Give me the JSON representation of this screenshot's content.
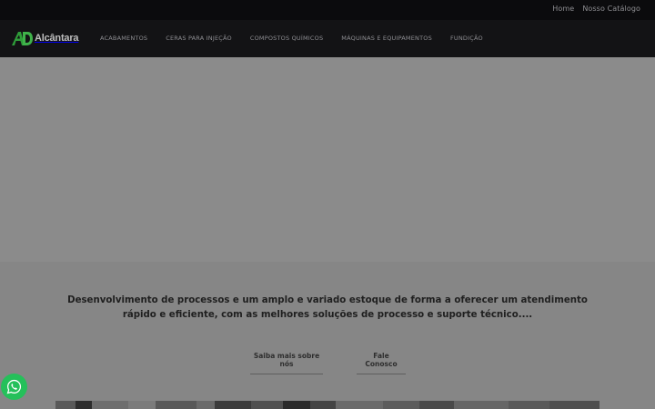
{
  "top_links": [
    {
      "label": "Home"
    },
    {
      "label": "Nosso Catálogo"
    }
  ],
  "logo": {
    "mark": "AD",
    "text": "Alcântara",
    "color": "#2f9e3a"
  },
  "nav": [
    {
      "label": "ACABAMENTOS"
    },
    {
      "label": "CERAS PARA INJEÇÃO"
    },
    {
      "label": "COMPOSTOS QUÍMICOS"
    },
    {
      "label": "MÁQUINAS E EQUIPAMENTOS"
    },
    {
      "label": "FUNDIÇÃO"
    }
  ],
  "main": {
    "headline": "Desenvolvimento de processos e um amplo e variado estoque de forma a oferecer um atendimento rápido e eficiente, com as melhores soluções de processo e suporte técnico....",
    "buttons": {
      "about": "Saiba mais sobre nós",
      "contact": "Fale Conosco"
    }
  },
  "icons": {
    "whatsapp": "whatsapp-icon",
    "whatsapp_color": "#25c05a"
  }
}
